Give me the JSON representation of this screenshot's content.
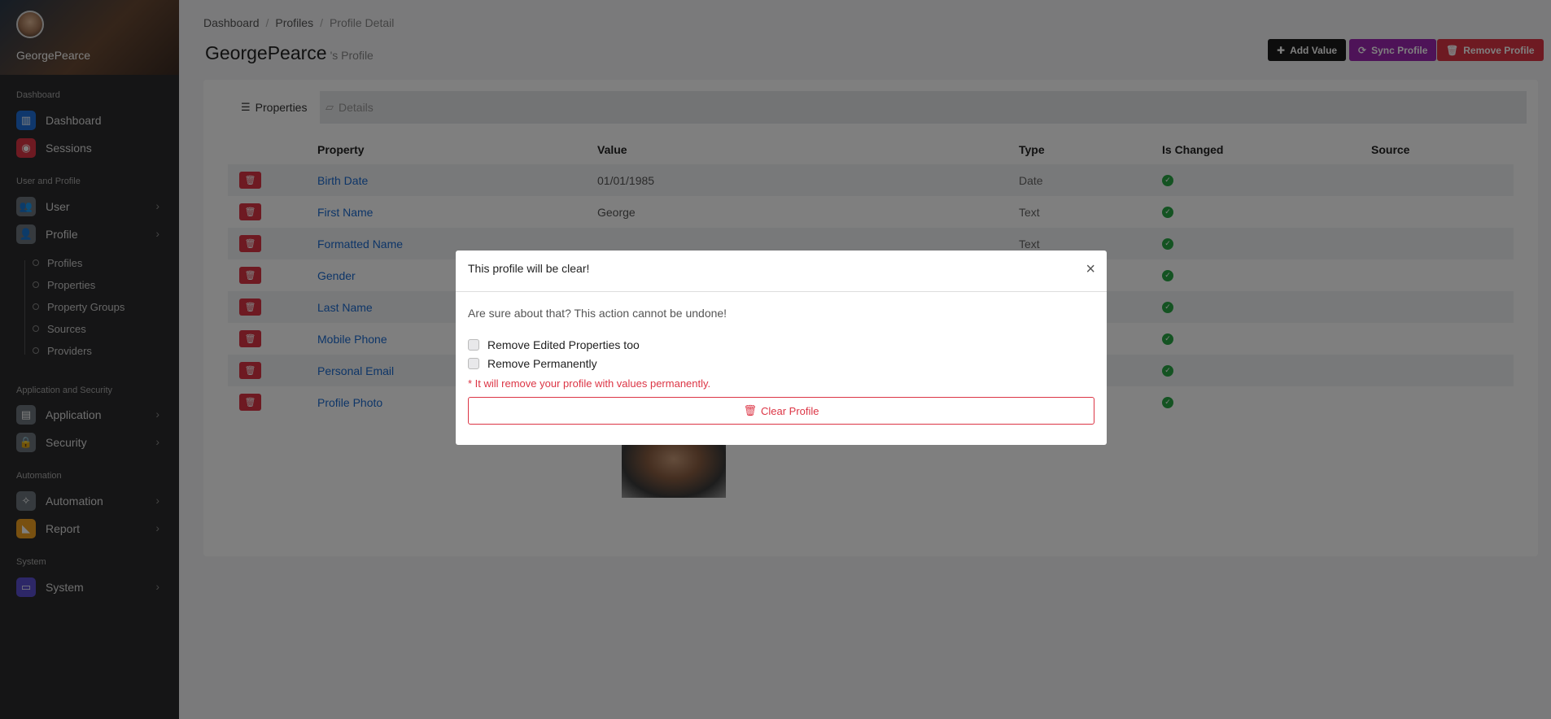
{
  "sidebar": {
    "user_name": "GeorgePearce",
    "sections": [
      {
        "label": "Dashboard"
      },
      {
        "label": "User and Profile"
      },
      {
        "label": "Application and Security"
      },
      {
        "label": "Automation"
      },
      {
        "label": "System"
      }
    ],
    "items": {
      "dashboard": {
        "label": "Dashboard",
        "color": "#1e6fd9",
        "icon": "chart-icon"
      },
      "sessions": {
        "label": "Sessions",
        "color": "#dc3545",
        "icon": "record-icon"
      },
      "user": {
        "label": "User",
        "color": "#6c757d",
        "icon": "users-icon"
      },
      "profile": {
        "label": "Profile",
        "color": "#6c757d",
        "icon": "person-icon"
      },
      "application": {
        "label": "Application",
        "color": "#6c757d",
        "icon": "window-icon"
      },
      "security": {
        "label": "Security",
        "color": "#6c757d",
        "icon": "lock-icon"
      },
      "automation": {
        "label": "Automation",
        "color": "#6c757d",
        "icon": "wand-icon"
      },
      "report": {
        "label": "Report",
        "color": "#f0a020",
        "icon": "area-chart-icon"
      },
      "system": {
        "label": "System",
        "color": "#5a4fcf",
        "icon": "monitor-icon"
      }
    },
    "profile_sub": [
      "Profiles",
      "Properties",
      "Property Groups",
      "Sources",
      "Providers"
    ]
  },
  "breadcrumb": [
    "Dashboard",
    "Profiles",
    "Profile Detail"
  ],
  "page": {
    "title": "GeorgePearce",
    "subtitle": "'s Profile"
  },
  "actions": {
    "add_value": "Add Value",
    "sync_profile": "Sync Profile",
    "remove_profile": "Remove Profile",
    "colors": {
      "add": "#1a1a1a",
      "sync": "#9c27b0",
      "remove": "#dc3545"
    }
  },
  "tabs": {
    "properties": "Properties",
    "details": "Details"
  },
  "table": {
    "headers": {
      "property": "Property",
      "value": "Value",
      "type": "Type",
      "is_changed": "Is Changed",
      "source": "Source"
    },
    "rows": [
      {
        "property": "Birth Date",
        "value": "01/01/1985",
        "type": "Date"
      },
      {
        "property": "First Name",
        "value": "George",
        "type": "Text"
      },
      {
        "property": "Formatted Name",
        "value": "",
        "type": "Text"
      },
      {
        "property": "Gender",
        "value": "",
        "type": ""
      },
      {
        "property": "Last Name",
        "value": "",
        "type": ""
      },
      {
        "property": "Mobile Phone",
        "value": "",
        "type": ""
      },
      {
        "property": "Personal Email",
        "value": "",
        "type": ""
      },
      {
        "property": "Profile Photo",
        "value": "",
        "type": ""
      }
    ]
  },
  "modal": {
    "title": "This profile will be clear!",
    "close": "×",
    "message": "Are sure about that? This action cannot be undone!",
    "checkbox_edited": "Remove Edited Properties too",
    "checkbox_permanent": "Remove Permanently",
    "warning": "* It will remove your profile with values permanently.",
    "clear_button": "Clear Profile"
  }
}
